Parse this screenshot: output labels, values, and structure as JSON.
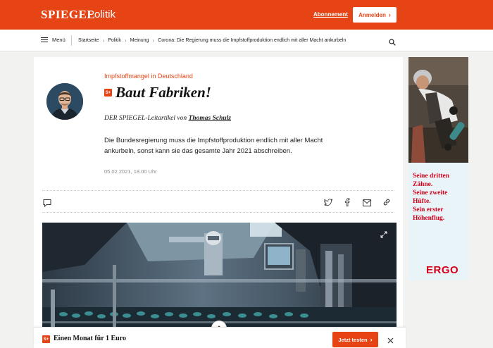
{
  "header": {
    "logo": "SPIEGEL",
    "section": "Politik",
    "subscription_link": "Abonnement",
    "login_button": "Anmelden",
    "brand_color": "#e64415"
  },
  "nav": {
    "menu_label": "Menü",
    "breadcrumbs": [
      "Startseite",
      "Politik",
      "Meinung",
      "Corona: Die Regierung muss die Impfstoffproduktion endlich mit aller Macht ankurbeln"
    ]
  },
  "article": {
    "kicker": "Impfstoffmangel in Deutschland",
    "plus_badge": "S+",
    "headline": "Baut Fabriken!",
    "byline_prefix": "DER SPIEGEL-Leitartikel von",
    "author": "Thomas Schulz",
    "teaser": "Die Bundesregierung muss die Impfstoffproduktion endlich mit aller Macht ankurbeln, sonst kann sie das gesamte Jahr 2021 abschreiben.",
    "date": "05.02.2021, 18.00 Uhr"
  },
  "ad": {
    "text_lines": [
      "Seine dritten",
      "Zähne.",
      "Seine zweite",
      "Hüfte.",
      "Sein erster",
      "Höhenflug."
    ],
    "brand": "ERGO",
    "brand_color": "#d6001c"
  },
  "promo": {
    "badge": "S+",
    "text": "Einen Monat für 1 Euro",
    "button": "Jetzt testen"
  }
}
